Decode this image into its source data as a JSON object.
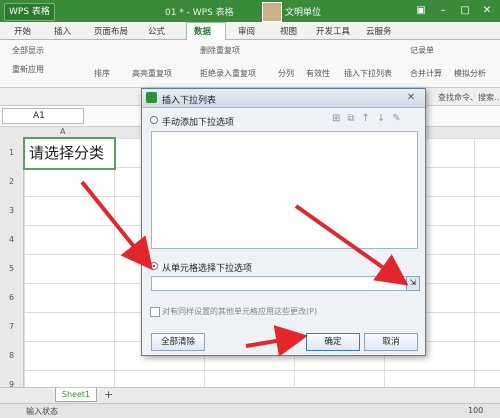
{
  "app": {
    "logo": "WPS 表格",
    "doc_title": "01 * - WPS 表格",
    "user": "文明单位"
  },
  "menu": [
    "开始",
    "插入",
    "页面布局",
    "公式",
    "数据",
    "审阅",
    "视图",
    "开发工具",
    "云服务"
  ],
  "menu_active": "数据",
  "ribbon": {
    "show_all": "全部显示",
    "reapply": "重新应用",
    "sort": "排序",
    "highlight_dup": "高亮重复项",
    "delete_dup": "删除重复项",
    "reject_dup": "拒绝录入重复项",
    "split": "分列",
    "validity": "有效性",
    "insert_dropdown": "插入下拉列表",
    "merge": "合并计算",
    "record": "记录单",
    "simulate": "模拟分析"
  },
  "qtb_search": "查找命令、搜索...",
  "formula_bar": {
    "cell_ref": "A1"
  },
  "columns": [
    "A"
  ],
  "rows": [
    "1",
    "2",
    "3",
    "4",
    "5",
    "6",
    "7",
    "8",
    "9"
  ],
  "cell_a1": "请选择分类",
  "dialog": {
    "title": "插入下拉列表",
    "manual": "手动添加下拉选项",
    "from_cells": "从单元格选择下拉选项",
    "apply_same": "对有同样设置的其他单元格应用这些更改(P)",
    "clear_all": "全部清除",
    "ok": "确定",
    "cancel": "取消"
  },
  "sheet_tab": "Sheet1",
  "status": {
    "mode": "输入状态",
    "zoom": "100"
  }
}
